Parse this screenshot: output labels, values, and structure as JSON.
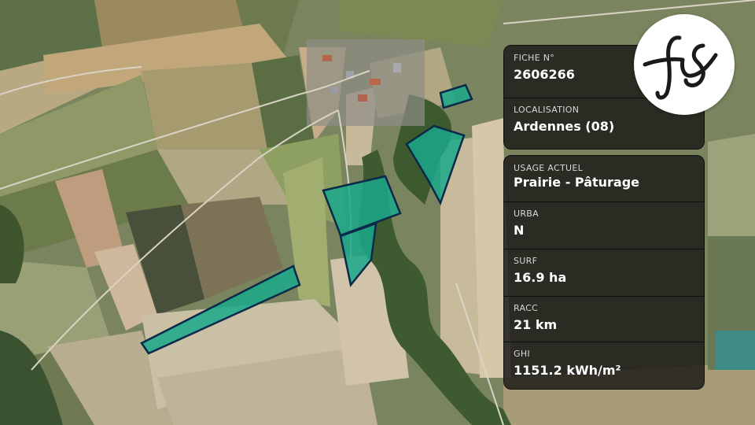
{
  "panel_top": [
    {
      "label": "FICHE N°",
      "value": "2606266"
    },
    {
      "label": "LOCALISATION",
      "value": "Ardennes (08)"
    }
  ],
  "panel_bottom": [
    {
      "label": "USAGE ACTUEL",
      "value": "Prairie - Pâturage"
    },
    {
      "label": "URBA",
      "value": "N"
    },
    {
      "label": "SURF",
      "value": "16.9 ha"
    },
    {
      "label": "RACC",
      "value": "21 km"
    },
    {
      "label": "GHI",
      "value": "1151.2 kWh/m²"
    }
  ],
  "colors": {
    "parcel_fill": "#1aa88a",
    "parcel_stroke": "#0b2a4a",
    "card_bg": "#1c1a18"
  },
  "logo_icon": "fs-monogram-icon"
}
